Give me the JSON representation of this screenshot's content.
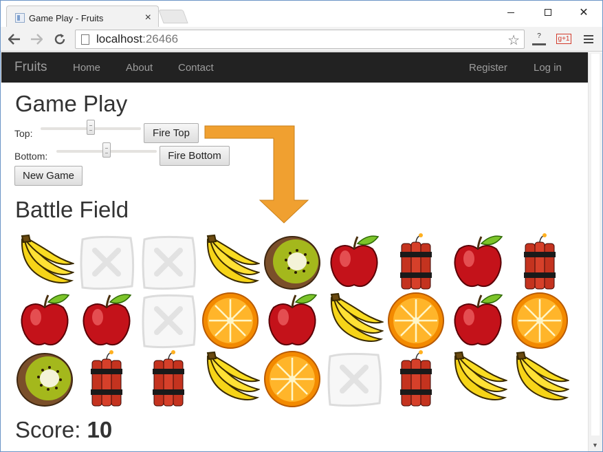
{
  "browser": {
    "tab_title": "Game Play - Fruits",
    "url_host": "localhost",
    "url_port": ":26466",
    "ext_gplus": "g+1",
    "ext_help": "?"
  },
  "navbar": {
    "brand": "Fruits",
    "links": [
      "Home",
      "About",
      "Contact"
    ],
    "right_links": [
      "Register",
      "Log in"
    ]
  },
  "game": {
    "title": "Game Play",
    "top_label": "Top:",
    "bottom_label": "Bottom:",
    "top_slider_value": 0.5,
    "bottom_slider_value": 0.5,
    "fire_top_label": "Fire Top",
    "fire_bottom_label": "Fire Bottom",
    "new_game_label": "New Game",
    "battlefield_title": "Battle Field",
    "score_label": "Score:",
    "score_value": "10",
    "grid": [
      [
        "banana",
        "empty",
        "empty",
        "banana",
        "kiwi",
        "apple",
        "dynamite",
        "apple",
        "dynamite"
      ],
      [
        "apple",
        "apple",
        "empty",
        "orange",
        "apple",
        "banana",
        "orange",
        "apple",
        "orange"
      ],
      [
        "kiwi",
        "dynamite",
        "dynamite",
        "banana",
        "orange",
        "empty",
        "dynamite",
        "banana",
        "banana"
      ]
    ]
  },
  "colors": {
    "navbar_bg": "#222222",
    "navbar_text": "#9d9d9d",
    "arrow": "#f0a030"
  }
}
